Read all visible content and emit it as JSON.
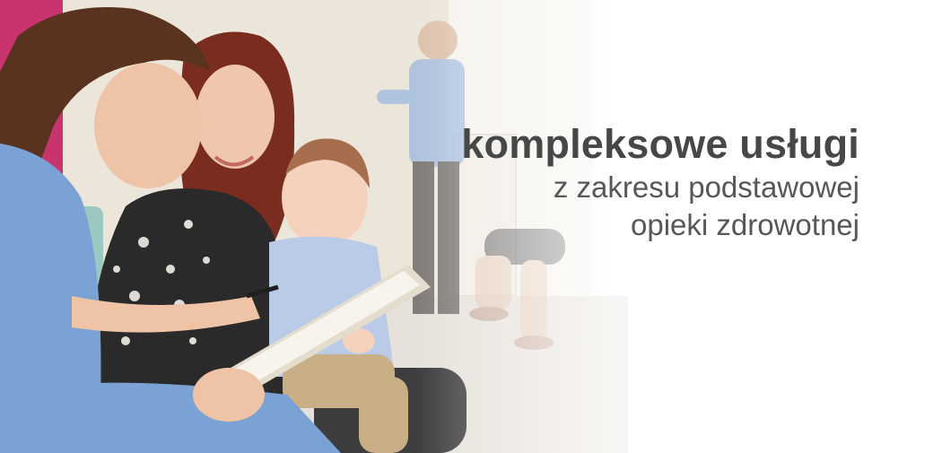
{
  "banner": {
    "headline_bold": "kompleksowe usługi",
    "headline_line2": "z zakresu podstawowej",
    "headline_line3": "opieki zdrowotnej",
    "colors": {
      "text": "#474747",
      "nurse_scrubs": "#7aa2d4",
      "background": "#ffffff"
    }
  }
}
